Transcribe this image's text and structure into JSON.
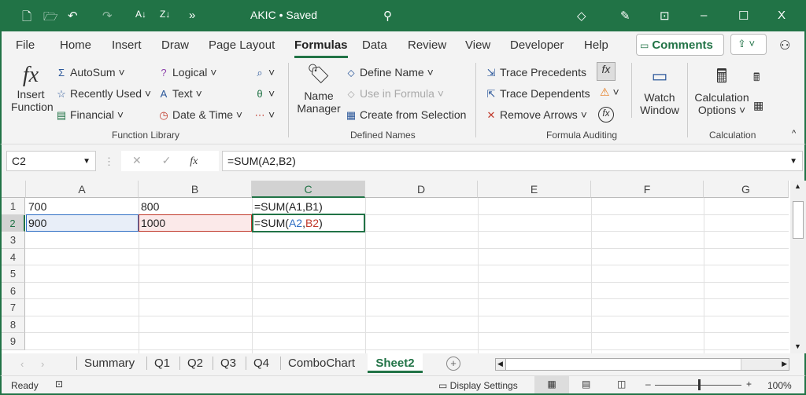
{
  "title": {
    "doc": "AKIC • Saved",
    "icons": [
      "new-icon",
      "open-icon",
      "undo-icon",
      "redo-icon",
      "sort-az-icon",
      "sort-za-icon",
      "more-icon",
      "search-icon",
      "premium-icon",
      "pen-icon",
      "restore-icon",
      "minimize-icon",
      "maximize-icon",
      "close-icon"
    ],
    "more": "»",
    "minimize": "–",
    "maximize": "☐",
    "close": "X"
  },
  "tabs": [
    "File",
    "Home",
    "Insert",
    "Draw",
    "Page Layout",
    "Formulas",
    "Data",
    "Review",
    "View",
    "Developer",
    "Help"
  ],
  "comments": "Comments",
  "ribbon": {
    "insert_function": [
      "Insert",
      "Function"
    ],
    "autosum": "AutoSum",
    "recently_used": "Recently Used",
    "financial": "Financial",
    "logical": "Logical",
    "text": "Text",
    "date_time": "Date & Time",
    "function_library": "Function Library",
    "name_manager": [
      "Name",
      "Manager"
    ],
    "define_name": "Define Name",
    "use_in_formula": "Use in Formula",
    "create_from_selection": "Create from Selection",
    "defined_names": "Defined Names",
    "trace_precedents": "Trace Precedents",
    "trace_dependents": "Trace Dependents",
    "remove_arrows": "Remove Arrows",
    "watch_window": [
      "Watch",
      "Window"
    ],
    "formula_auditing": "Formula Auditing",
    "calc_options": [
      "Calculation",
      "Options"
    ],
    "calculation": "Calculation"
  },
  "formula_bar": {
    "name_box": "C2",
    "formula": "=SUM(A2,B2)",
    "fx": "fx"
  },
  "columns": [
    "A",
    "B",
    "C",
    "D",
    "E",
    "F",
    "G"
  ],
  "rows": [
    "1",
    "2",
    "3",
    "4",
    "5",
    "6",
    "7",
    "8",
    "9"
  ],
  "cells": {
    "A1": "700",
    "B1": "800",
    "C1": "=SUM(A1,B1)",
    "A2": "900",
    "B2": "1000",
    "C2_prefix": "=SUM(",
    "C2_a": "A2",
    "C2_comma": ",",
    "C2_b": "B2",
    "C2_suffix": ")"
  },
  "sheets": [
    "Summary",
    "Q1",
    "Q2",
    "Q3",
    "Q4",
    "ComboChart",
    "Sheet2"
  ],
  "active_sheet": "Sheet2",
  "status": {
    "ready": "Ready",
    "display_settings": "Display Settings",
    "zoom": "100%"
  },
  "colors": {
    "green": "#217346",
    "ref_blue": "#2f6fc4",
    "ref_red": "#c0392b"
  }
}
